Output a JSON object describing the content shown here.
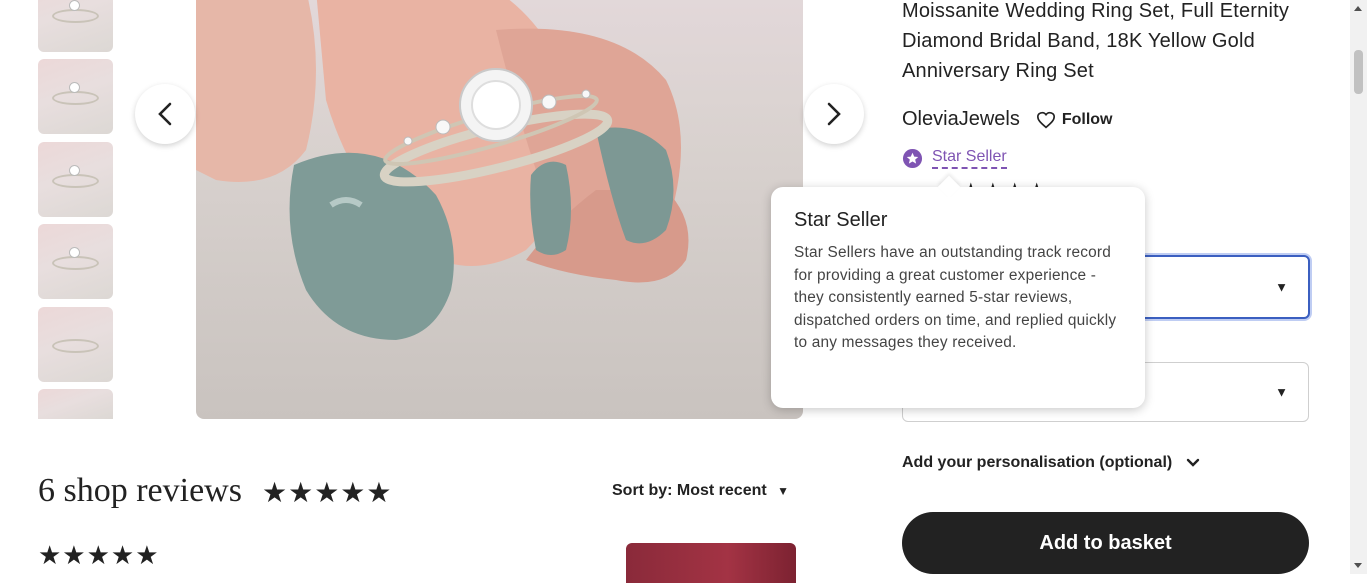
{
  "listing": {
    "title_line1": "Moissanite Wedding Ring Set, Full Eternity",
    "title_line2": "Diamond Bridal Band, 18K Yellow Gold",
    "title_line3": "Anniversary Ring Set"
  },
  "shop": {
    "name": "OleviaJewels",
    "follow_label": "Follow",
    "star_seller_label": "Star Seller",
    "rating_stars": "★★★★★"
  },
  "tooltip": {
    "title": "Star Seller",
    "body": "Star Sellers have an outstanding track record for providing a great customer experience - they consistently earned 5-star reviews, dispatched orders on time, and replied quickly to any messages they received."
  },
  "options": {
    "select1_value": "",
    "select2_value": "",
    "personalisation_label": "Add your personalisation (optional)"
  },
  "basket": {
    "label": "Add to basket"
  },
  "reviews": {
    "heading": "6 shop reviews",
    "stars": "★★★★★",
    "sort_label": "Sort by: Most recent",
    "first_review_stars": "★★★★★"
  },
  "colors": {
    "accent_purple": "#7f54b3",
    "basket_bg": "#222222",
    "focus_blue": "#3b5fc0"
  },
  "icons": [
    "chevron-left-icon",
    "chevron-right-icon",
    "heart-icon",
    "star-seller-badge-icon",
    "caret-down-icon",
    "chevron-down-icon"
  ]
}
